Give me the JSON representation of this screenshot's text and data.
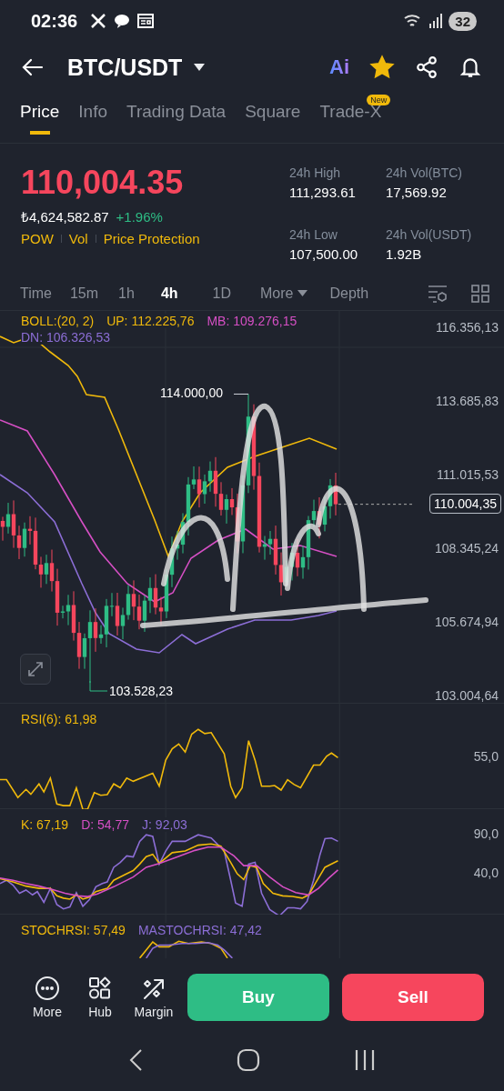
{
  "status_bar": {
    "time": "02:36",
    "battery": "32"
  },
  "header": {
    "pair": "BTC/USDT",
    "ai_badge": "Ai",
    "favorite": true
  },
  "tabs": [
    {
      "label": "Price",
      "selected": true
    },
    {
      "label": "Info",
      "selected": false
    },
    {
      "label": "Trading Data",
      "selected": false
    },
    {
      "label": "Square",
      "selected": false
    },
    {
      "label": "Trade-X",
      "selected": false,
      "badge": "New"
    }
  ],
  "ticker": {
    "last_price": "110,004.35",
    "fiat_price": "₺4,624,582.87",
    "change": "+1.96%",
    "tags": [
      "POW",
      "Vol",
      "Price Protection"
    ],
    "stats": [
      {
        "label": "24h High",
        "value": "111,293.61"
      },
      {
        "label": "24h Vol(BTC)",
        "value": "17,569.92"
      },
      {
        "label": "24h Low",
        "value": "107,500.00"
      },
      {
        "label": "24h Vol(USDT)",
        "value": "1.92B"
      }
    ]
  },
  "intervals": [
    {
      "label": "Time",
      "selected": false,
      "kind": "option"
    },
    {
      "label": "15m",
      "selected": false,
      "kind": "option"
    },
    {
      "label": "1h",
      "selected": false,
      "kind": "option"
    },
    {
      "label": "4h",
      "selected": true,
      "kind": "option"
    },
    {
      "label": "1D",
      "selected": false,
      "kind": "option"
    },
    {
      "label": "More",
      "selected": false,
      "kind": "dropdown"
    },
    {
      "label": "Depth",
      "selected": false,
      "kind": "option"
    }
  ],
  "chart": {
    "legend": [
      {
        "label": "BOLL:(20, 2)",
        "color": "#f0b90b"
      },
      {
        "label": "UP: 112.225,76",
        "color": "#f0b90b"
      },
      {
        "label": "MB: 109.276,15",
        "color": "#d54fc4"
      },
      {
        "label": "DN: 106.326,53",
        "color": "#8c6ed6"
      }
    ],
    "price_axis": [
      "116.356,13",
      "113.685,83",
      "111.015,53",
      "108.345,24",
      "105.674,94",
      "103.004,64"
    ],
    "high_marker": "114.000,00",
    "low_marker": "103.528,23",
    "last_price_tag": "110.004,35"
  },
  "rsi": {
    "legend": [
      {
        "label": "RSI(6): 61,98",
        "color": "#f0b90b"
      }
    ],
    "axis": [
      "55,0"
    ]
  },
  "kdj": {
    "legend": [
      {
        "label": "K: 67,19",
        "color": "#f0b90b"
      },
      {
        "label": "D: 54,77",
        "color": "#d54fc4"
      },
      {
        "label": "J: 92,03",
        "color": "#8c6ed6"
      }
    ],
    "axis": [
      "90,0",
      "40,0"
    ]
  },
  "stochrsi": {
    "legend": [
      {
        "label": "STOCHRSI: 57,49",
        "color": "#f0b90b"
      },
      {
        "label": "MASTOCHRSI: 47,42",
        "color": "#8c6ed6"
      }
    ]
  },
  "bottom_bar": {
    "actions": [
      {
        "label": "More"
      },
      {
        "label": "Hub"
      },
      {
        "label": "Margin"
      }
    ],
    "buy": "Buy",
    "sell": "Sell"
  }
}
